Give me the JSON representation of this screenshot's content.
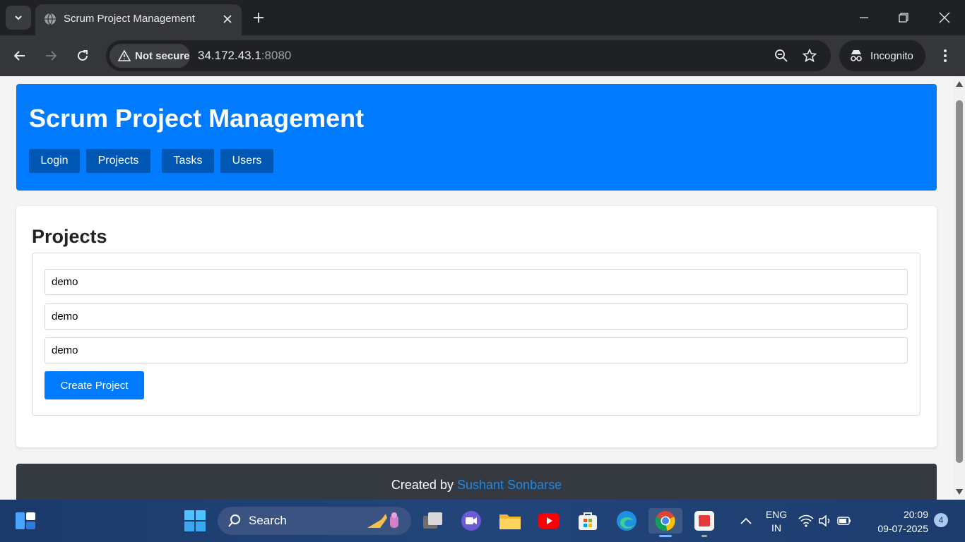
{
  "browser": {
    "tab_title": "Scrum Project Management",
    "security_label": "Not secure",
    "url_host": "34.172.43.1",
    "url_port": ":8080",
    "profile_label": "Incognito"
  },
  "header": {
    "title": "Scrum Project Management",
    "nav": [
      {
        "label": "Login"
      },
      {
        "label": "Projects"
      },
      {
        "label": "Tasks"
      },
      {
        "label": "Users"
      }
    ]
  },
  "projects": {
    "heading": "Projects",
    "fields": [
      {
        "value": "demo"
      },
      {
        "value": "demo"
      },
      {
        "value": "demo"
      }
    ],
    "create_label": "Create Project"
  },
  "footer": {
    "prefix": "Created by",
    "author": "Sushant Sonbarse"
  },
  "taskbar": {
    "search_label": "Search",
    "lang_top": "ENG",
    "lang_bottom": "IN",
    "time": "20:09",
    "date": "09-07-2025",
    "notifications": "4"
  },
  "colors": {
    "accent": "#007bff",
    "nav_button": "#0056b3",
    "footer": "#343a40",
    "footer_link": "#1e88e5"
  }
}
